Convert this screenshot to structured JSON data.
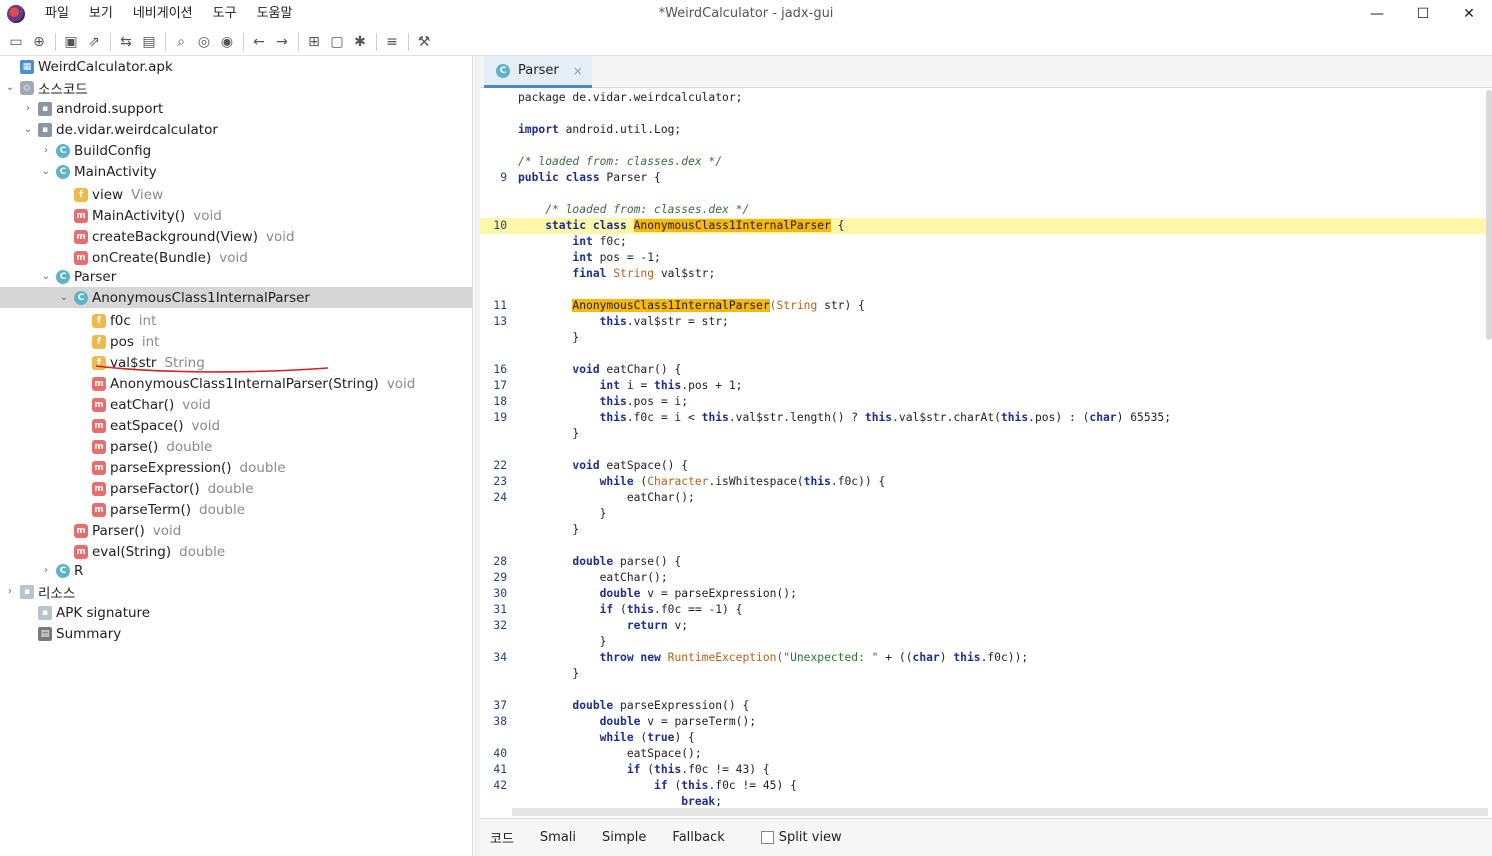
{
  "window": {
    "title": "*WeirdCalculator - jadx-gui",
    "menu": [
      "파일",
      "보기",
      "네비게이션",
      "도구",
      "도움말"
    ],
    "controls": {
      "minimize": "—",
      "maximize": "☐",
      "close": "✕"
    }
  },
  "toolbar": {
    "icons": [
      "open-icon",
      "add-files-icon",
      "save-icon",
      "export-icon",
      "sync-icon",
      "decompile-all-icon",
      "search-icon",
      "find-class-icon",
      "find-usage-icon",
      "back-icon",
      "forward-icon",
      "quark-icon",
      "deobfuscation-icon",
      "debug-icon",
      "log-icon",
      "preferences-icon"
    ],
    "glyphs": [
      "▭",
      "⊕",
      "▣",
      "⇗",
      "⇆",
      "▤",
      "⌕",
      "◎",
      "◉",
      "←",
      "→",
      "⊞",
      "▢",
      "✱",
      "≡",
      "⚒"
    ]
  },
  "tree": {
    "rows": [
      {
        "label": "WeirdCalculator.apk",
        "type": "",
        "icon": "apk",
        "arrow": ""
      },
      {
        "label": "소스코드",
        "type": "",
        "icon": "src",
        "arrow": "⌄"
      },
      {
        "label": "android.support",
        "type": "",
        "icon": "pkg",
        "arrow": "›"
      },
      {
        "label": "de.vidar.weirdcalculator",
        "type": "",
        "icon": "pkg",
        "arrow": "⌄"
      },
      {
        "label": "BuildConfig",
        "type": "",
        "icon": "class",
        "arrow": "›"
      },
      {
        "label": "MainActivity",
        "type": "",
        "icon": "class",
        "arrow": "⌄"
      },
      {
        "label": "view",
        "type": "View",
        "icon": "field",
        "arrow": ""
      },
      {
        "label": "MainActivity()",
        "type": "void",
        "icon": "method",
        "arrow": ""
      },
      {
        "label": "createBackground(View)",
        "type": "void",
        "icon": "method",
        "arrow": ""
      },
      {
        "label": "onCreate(Bundle)",
        "type": "void",
        "icon": "method",
        "arrow": ""
      },
      {
        "label": "Parser",
        "type": "",
        "icon": "class",
        "arrow": "⌄"
      },
      {
        "label": "AnonymousClass1InternalParser",
        "type": "",
        "icon": "class",
        "arrow": "⌄"
      },
      {
        "label": "f0c",
        "type": "int",
        "icon": "field",
        "arrow": ""
      },
      {
        "label": "pos",
        "type": "int",
        "icon": "field",
        "arrow": ""
      },
      {
        "label": "val$str",
        "type": "String",
        "icon": "field",
        "arrow": ""
      },
      {
        "label": "AnonymousClass1InternalParser(String)",
        "type": "void",
        "icon": "method",
        "arrow": ""
      },
      {
        "label": "eatChar()",
        "type": "void",
        "icon": "method",
        "arrow": ""
      },
      {
        "label": "eatSpace()",
        "type": "void",
        "icon": "method",
        "arrow": ""
      },
      {
        "label": "parse()",
        "type": "double",
        "icon": "method",
        "arrow": ""
      },
      {
        "label": "parseExpression()",
        "type": "double",
        "icon": "method",
        "arrow": ""
      },
      {
        "label": "parseFactor()",
        "type": "double",
        "icon": "method",
        "arrow": ""
      },
      {
        "label": "parseTerm()",
        "type": "double",
        "icon": "method",
        "arrow": ""
      },
      {
        "label": "Parser()",
        "type": "void",
        "icon": "method",
        "arrow": ""
      },
      {
        "label": "eval(String)",
        "type": "double",
        "icon": "method",
        "arrow": ""
      },
      {
        "label": "R",
        "type": "",
        "icon": "class",
        "arrow": "›"
      },
      {
        "label": "리소스",
        "type": "",
        "icon": "folder",
        "arrow": "›"
      },
      {
        "label": "APK signature",
        "type": "",
        "icon": "folder",
        "arrow": ""
      },
      {
        "label": "Summary",
        "type": "",
        "icon": "sum",
        "arrow": ""
      }
    ],
    "icon_letters": {
      "class": "C",
      "method": "m",
      "field": "f",
      "pkg": "▪",
      "apk": "▦",
      "folder": "▪",
      "sum": "▤",
      "src": "◇"
    }
  },
  "editor": {
    "tab": {
      "label": "Parser",
      "close": "×"
    },
    "code_lines": [
      {
        "n": "",
        "t": [
          [
            "nm",
            "package de.vidar.weirdcalculator;"
          ]
        ]
      },
      {
        "n": "",
        "t": []
      },
      {
        "n": "",
        "t": [
          [
            "kw",
            "import"
          ],
          [
            "nm",
            " android.util.Log;"
          ]
        ]
      },
      {
        "n": "",
        "t": []
      },
      {
        "n": "",
        "t": [
          [
            "cm",
            "/* loaded from: classes.dex */"
          ]
        ]
      },
      {
        "n": "9",
        "t": [
          [
            "kw",
            "public class"
          ],
          [
            "nm",
            " Parser {"
          ]
        ]
      },
      {
        "n": "",
        "t": []
      },
      {
        "n": "",
        "t": [
          [
            "cm",
            "    /* loaded from: classes.dex */"
          ]
        ]
      },
      {
        "n": "10",
        "hl": true,
        "t": [
          [
            "kw",
            "    static class "
          ],
          [
            "mark",
            "AnonymousClass1InternalParser"
          ],
          [
            "nm",
            " {"
          ]
        ]
      },
      {
        "n": "",
        "t": [
          [
            "kw",
            "        int"
          ],
          [
            "nm",
            " f0c;"
          ]
        ]
      },
      {
        "n": "",
        "t": [
          [
            "kw",
            "        int"
          ],
          [
            "nm",
            " pos = -1;"
          ]
        ]
      },
      {
        "n": "",
        "t": [
          [
            "kw",
            "        final "
          ],
          [
            "ty",
            "String"
          ],
          [
            "nm",
            " val$str;"
          ]
        ]
      },
      {
        "n": "",
        "t": []
      },
      {
        "n": "11",
        "t": [
          [
            "nm",
            "        "
          ],
          [
            "mark",
            "AnonymousClass1InternalParser"
          ],
          [
            "ty",
            "(String"
          ],
          [
            "nm",
            " str) {"
          ]
        ]
      },
      {
        "n": "13",
        "t": [
          [
            "kw",
            "            this"
          ],
          [
            "nm",
            ".val$str = str;"
          ]
        ]
      },
      {
        "n": "",
        "t": [
          [
            "nm",
            "        }"
          ]
        ]
      },
      {
        "n": "",
        "t": []
      },
      {
        "n": "16",
        "t": [
          [
            "kw",
            "        void"
          ],
          [
            "nm",
            " eatChar() {"
          ]
        ]
      },
      {
        "n": "17",
        "t": [
          [
            "kw",
            "            int"
          ],
          [
            "nm",
            " i = "
          ],
          [
            "kw",
            "this"
          ],
          [
            "nm",
            ".pos + 1;"
          ]
        ]
      },
      {
        "n": "18",
        "t": [
          [
            "kw",
            "            this"
          ],
          [
            "nm",
            ".pos = i;"
          ]
        ]
      },
      {
        "n": "19",
        "t": [
          [
            "kw",
            "            this"
          ],
          [
            "nm",
            ".f0c = i < "
          ],
          [
            "kw",
            "this"
          ],
          [
            "nm",
            ".val$str.length() ? "
          ],
          [
            "kw",
            "this"
          ],
          [
            "nm",
            ".val$str.charAt("
          ],
          [
            "kw",
            "this"
          ],
          [
            "nm",
            ".pos) : ("
          ],
          [
            "kw",
            "char"
          ],
          [
            "nm",
            ") 65535;"
          ]
        ]
      },
      {
        "n": "",
        "t": [
          [
            "nm",
            "        }"
          ]
        ]
      },
      {
        "n": "",
        "t": []
      },
      {
        "n": "22",
        "t": [
          [
            "kw",
            "        void"
          ],
          [
            "nm",
            " eatSpace() {"
          ]
        ]
      },
      {
        "n": "23",
        "t": [
          [
            "kw",
            "            while"
          ],
          [
            "nm",
            " ("
          ],
          [
            "ty",
            "Character"
          ],
          [
            "nm",
            ".isWhitespace("
          ],
          [
            "kw",
            "this"
          ],
          [
            "nm",
            ".f0c)) {"
          ]
        ]
      },
      {
        "n": "24",
        "t": [
          [
            "nm",
            "                eatChar();"
          ]
        ]
      },
      {
        "n": "",
        "t": [
          [
            "nm",
            "            }"
          ]
        ]
      },
      {
        "n": "",
        "t": [
          [
            "nm",
            "        }"
          ]
        ]
      },
      {
        "n": "",
        "t": []
      },
      {
        "n": "28",
        "t": [
          [
            "kw",
            "        double"
          ],
          [
            "nm",
            " parse() {"
          ]
        ]
      },
      {
        "n": "29",
        "t": [
          [
            "nm",
            "            eatChar();"
          ]
        ]
      },
      {
        "n": "30",
        "t": [
          [
            "kw",
            "            double"
          ],
          [
            "nm",
            " v = parseExpression();"
          ]
        ]
      },
      {
        "n": "31",
        "t": [
          [
            "kw",
            "            if"
          ],
          [
            "nm",
            " ("
          ],
          [
            "kw",
            "this"
          ],
          [
            "nm",
            ".f0c == -1) {"
          ]
        ]
      },
      {
        "n": "32",
        "t": [
          [
            "kw",
            "                return"
          ],
          [
            "nm",
            " v;"
          ]
        ]
      },
      {
        "n": "",
        "t": [
          [
            "nm",
            "            }"
          ]
        ]
      },
      {
        "n": "34",
        "t": [
          [
            "kw",
            "            throw new "
          ],
          [
            "ty",
            "RuntimeException"
          ],
          [
            "st",
            "(\"Unexpected: \""
          ],
          [
            "nm",
            " + (("
          ],
          [
            "kw",
            "char"
          ],
          [
            "nm",
            ") "
          ],
          [
            "kw",
            "this"
          ],
          [
            "nm",
            ".f0c));"
          ]
        ]
      },
      {
        "n": "",
        "t": [
          [
            "nm",
            "        }"
          ]
        ]
      },
      {
        "n": "",
        "t": []
      },
      {
        "n": "37",
        "t": [
          [
            "kw",
            "        double"
          ],
          [
            "nm",
            " parseExpression() {"
          ]
        ]
      },
      {
        "n": "38",
        "t": [
          [
            "kw",
            "            double"
          ],
          [
            "nm",
            " v = parseTerm();"
          ]
        ]
      },
      {
        "n": "",
        "t": [
          [
            "kw",
            "            while"
          ],
          [
            "nm",
            " ("
          ],
          [
            "kw",
            "true"
          ],
          [
            "nm",
            ") {"
          ]
        ]
      },
      {
        "n": "40",
        "t": [
          [
            "nm",
            "                eatSpace();"
          ]
        ]
      },
      {
        "n": "41",
        "t": [
          [
            "kw",
            "                if"
          ],
          [
            "nm",
            " ("
          ],
          [
            "kw",
            "this"
          ],
          [
            "nm",
            ".f0c != 43) {"
          ]
        ]
      },
      {
        "n": "42",
        "t": [
          [
            "kw",
            "                    if"
          ],
          [
            "nm",
            " ("
          ],
          [
            "kw",
            "this"
          ],
          [
            "nm",
            ".f0c != 45) {"
          ]
        ]
      },
      {
        "n": "",
        "t": [
          [
            "kw",
            "                        break"
          ],
          [
            "nm",
            ";"
          ]
        ]
      }
    ],
    "bottom_tabs": [
      "코드",
      "Smali",
      "Simple",
      "Fallback"
    ],
    "split_view_label": "Split view"
  }
}
